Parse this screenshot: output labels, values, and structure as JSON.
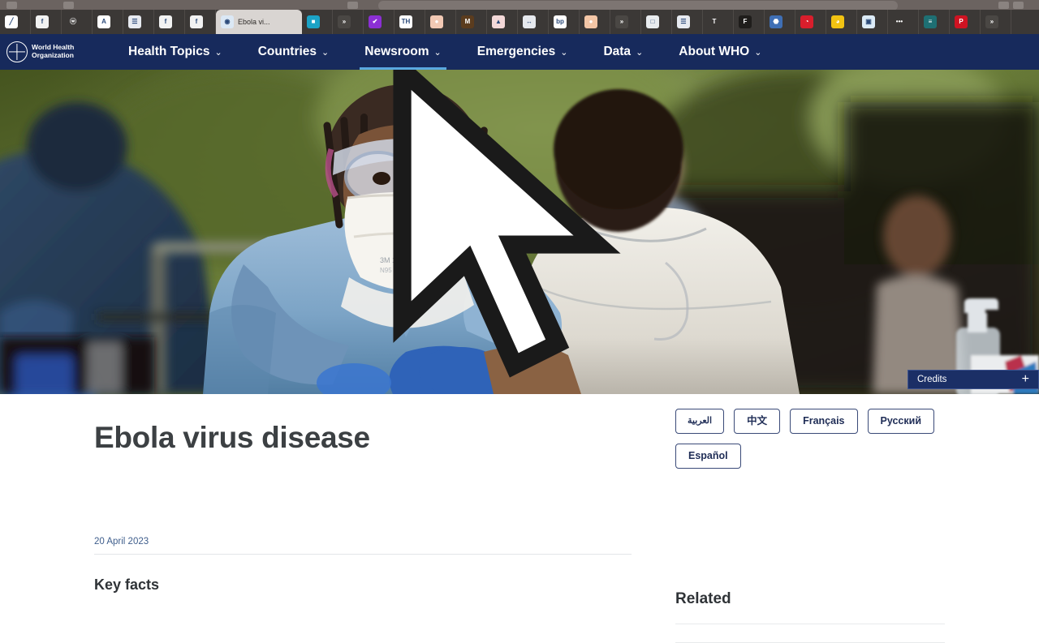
{
  "browser": {
    "tabs": [
      {
        "title": "",
        "favicon": "doc-icon",
        "color": "#ffffff",
        "glyph": "╱",
        "active": false
      },
      {
        "title": "",
        "favicon": "facebook-icon",
        "color": "#f2f2f2",
        "glyph": "f",
        "active": false
      },
      {
        "title": "",
        "favicon": "w-icon",
        "color": "#3b3836",
        "glyph": "ⓦ",
        "active": false
      },
      {
        "title": "",
        "favicon": "a-letter-icon",
        "color": "#ffffff",
        "glyph": "A",
        "active": false
      },
      {
        "title": "",
        "favicon": "book-icon",
        "color": "#e7eaf0",
        "glyph": "☰",
        "active": false
      },
      {
        "title": "",
        "favicon": "facebook-icon",
        "color": "#f2f2f2",
        "glyph": "f",
        "active": false
      },
      {
        "title": "",
        "favicon": "facebook-icon",
        "color": "#f2f2f2",
        "glyph": "f",
        "active": false
      },
      {
        "title": "Ebola vi...",
        "favicon": "who-favicon",
        "color": "#dbe8f5",
        "glyph": "◉",
        "active": true
      },
      {
        "title": "",
        "favicon": "teal-square-icon",
        "color": "#1ba3c6",
        "glyph": "■",
        "active": false
      },
      {
        "title": "",
        "favicon": "dd-icon",
        "color": "#4a4744",
        "glyph": "»",
        "active": false
      },
      {
        "title": "",
        "favicon": "purple-check-icon",
        "color": "#8b2fd4",
        "glyph": "✔",
        "active": false
      },
      {
        "title": "",
        "favicon": "tm-icon",
        "color": "#ffffff",
        "glyph": "TH",
        "active": false
      },
      {
        "title": "",
        "favicon": "peach-circle-icon",
        "color": "#f2c9b4",
        "glyph": "●",
        "active": false
      },
      {
        "title": "",
        "favicon": "m-badge-icon",
        "color": "#5b3c1e",
        "glyph": "M",
        "active": false
      },
      {
        "title": "",
        "favicon": "red-shape-icon",
        "color": "#f3d8d8",
        "glyph": "▲",
        "active": false
      },
      {
        "title": "",
        "favicon": "va-icon",
        "color": "#e6e9ee",
        "glyph": "↔",
        "active": false
      },
      {
        "title": "",
        "favicon": "bp-icon",
        "color": "#ffffff",
        "glyph": "bp",
        "active": false
      },
      {
        "title": "",
        "favicon": "peach-circle-icon",
        "color": "#f3c6a6",
        "glyph": "●",
        "active": false
      },
      {
        "title": "",
        "favicon": "dd-icon",
        "color": "#4a4744",
        "glyph": "»",
        "active": false
      },
      {
        "title": "",
        "favicon": "grey-square-icon",
        "color": "#e9ecef",
        "glyph": "□",
        "active": false
      },
      {
        "title": "",
        "favicon": "book-icon",
        "color": "#e7eaf0",
        "glyph": "☰",
        "active": false
      },
      {
        "title": "",
        "favicon": "t-letter-icon",
        "color": "#3b3836",
        "glyph": "T",
        "active": false
      },
      {
        "title": "",
        "favicon": "f-boxed-icon",
        "color": "#1f1d1b",
        "glyph": "F",
        "active": false
      },
      {
        "title": "",
        "favicon": "shield-icon",
        "color": "#3f6fb5",
        "glyph": "⬣",
        "active": false
      },
      {
        "title": "",
        "favicon": "red-cap-icon",
        "color": "#d81e2c",
        "glyph": "◔",
        "active": false
      },
      {
        "title": "",
        "favicon": "yellow-circle-icon",
        "color": "#f2c312",
        "glyph": "◕",
        "active": false
      },
      {
        "title": "",
        "favicon": "blue-doc-icon",
        "color": "#dcebf7",
        "glyph": "▣",
        "active": false
      },
      {
        "title": "",
        "favicon": "dots-icon",
        "color": "#3b3836",
        "glyph": "•••",
        "active": false
      },
      {
        "title": "",
        "favicon": "teal-bars-icon",
        "color": "#1e6f73",
        "glyph": "≡",
        "active": false
      },
      {
        "title": "",
        "favicon": "p-red-icon",
        "color": "#cf1322",
        "glyph": "P",
        "active": false
      },
      {
        "title": "",
        "favicon": "dd-icon",
        "color": "#4a4744",
        "glyph": "»",
        "active": false
      }
    ]
  },
  "header": {
    "logo": {
      "line1": "World Health",
      "line2": "Organization",
      "alt": "who-emblem"
    },
    "nav": [
      {
        "label": "Health Topics",
        "caret": "⌄",
        "active": false
      },
      {
        "label": "Countries",
        "caret": "⌄",
        "active": false
      },
      {
        "label": "Newsroom",
        "caret": "⌄",
        "active": true
      },
      {
        "label": "Emergencies",
        "caret": "⌄",
        "active": false
      },
      {
        "label": "Data",
        "caret": "⌄",
        "active": false
      },
      {
        "label": "About WHO",
        "caret": "⌄",
        "active": false
      }
    ],
    "nav_bg": "#172a5c",
    "active_underline": "#5aa8e0"
  },
  "hero": {
    "alt": "health-worker-in-ppe-treating-patient",
    "credits_label": "Credits",
    "credits_expand": "+"
  },
  "main": {
    "title": "Ebola virus disease",
    "date": "20 April 2023",
    "section_heading": "Key facts"
  },
  "languages": {
    "buttons": [
      {
        "label": "العربية",
        "rtl": true
      },
      {
        "label": "中文",
        "rtl": false
      },
      {
        "label": "Français",
        "rtl": false
      },
      {
        "label": "Русский",
        "rtl": false
      },
      {
        "label": "Español",
        "rtl": false
      }
    ],
    "border_color": "#3a4a78"
  },
  "sidebar": {
    "related_title": "Related"
  }
}
